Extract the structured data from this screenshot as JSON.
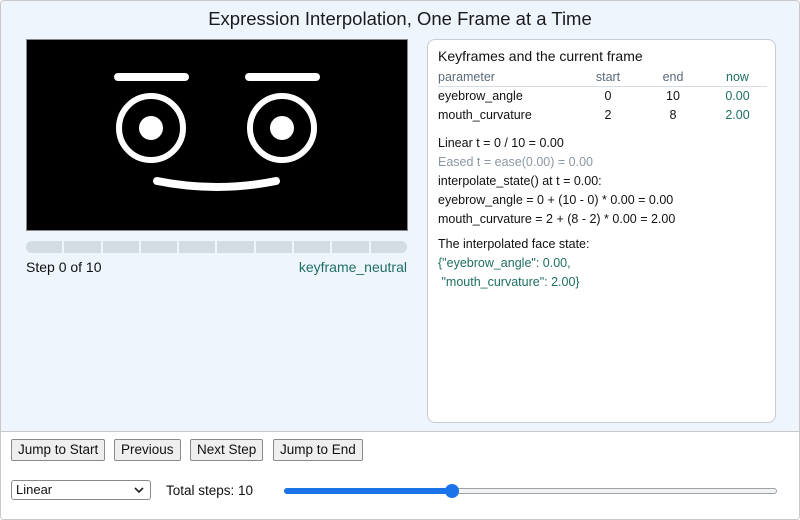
{
  "title": "Expression Interpolation, One Frame at a Time",
  "viewer": {
    "step_label": "Step 0 of 10",
    "keyframe_label": "keyframe_neutral",
    "progress_segments": 10,
    "progress_filled": 0
  },
  "panel": {
    "heading": "Keyframes and the current frame",
    "columns": [
      "parameter",
      "start",
      "end",
      "now"
    ],
    "rows": [
      {
        "parameter": "eyebrow_angle",
        "start": "0",
        "end": "10",
        "now": "0.00"
      },
      {
        "parameter": "mouth_curvature",
        "start": "2",
        "end": "8",
        "now": "2.00"
      }
    ],
    "linear_t": "Linear t = 0 / 10 = 0.00",
    "eased_t": "Eased t = ease(0.00) = 0.00",
    "interp_heading": "interpolate_state() at t = 0.00:",
    "interp_lines": [
      "eyebrow_angle = 0 + (10 - 0) * 0.00 = 0.00",
      "mouth_curvature = 2 + (8 - 2) * 0.00 = 2.00"
    ],
    "state_heading": "The interpolated face state:",
    "state_lines": [
      "{\"eyebrow_angle\": 0.00,",
      " \"mouth_curvature\": 2.00}"
    ]
  },
  "controls": {
    "jump_start": "Jump to Start",
    "previous": "Previous",
    "next": "Next Step",
    "jump_end": "Jump to End",
    "easing_selected": "Linear",
    "total_steps_label": "Total steps: 10",
    "total_steps_slider_fraction": 0.34
  },
  "colors": {
    "accent": "#1a73e8",
    "teal": "#1f6e62",
    "face_bg": "#000000",
    "face_stroke": "#ffffff"
  }
}
